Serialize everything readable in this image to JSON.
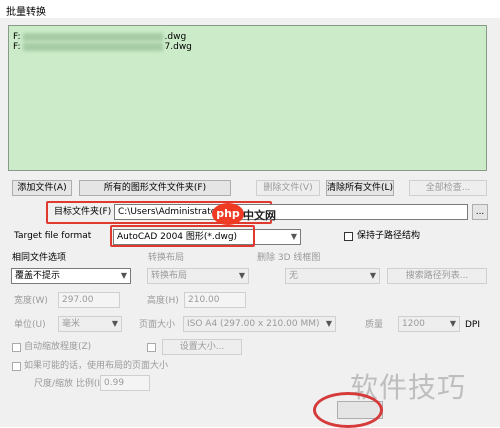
{
  "window": {
    "title": "批量转换"
  },
  "file_list": {
    "rows": [
      {
        "prefix": "F:",
        "suffix": ".dwg"
      },
      {
        "prefix": "F:",
        "suffix": "7.dwg"
      }
    ]
  },
  "buttons": {
    "add_file": "添加文件(A)",
    "add_folder": "所有的图形文件文件夹(F)",
    "remove_file": "删除文件(V)",
    "clear_all": "清除所有文件(L)",
    "preview": "全部检查...",
    "browse": "...",
    "settings": "设置大小..."
  },
  "target_folder": {
    "label": "目标文件夹(F)",
    "value": "C:\\Users\\Administrator\\Des"
  },
  "target_format": {
    "label": "Target file format",
    "value": "AutoCAD 2004 图形(*.dwg)"
  },
  "keep_subdir": {
    "label": "保持子路径结构"
  },
  "same_name": {
    "label": "相同文件选项",
    "value": "覆盖不提示"
  },
  "convert_layout": {
    "label": "转换布局",
    "value": "转换布局"
  },
  "delete_3d": {
    "label": "删除 3D 线框图",
    "value": "无"
  },
  "search_path": {
    "label": "搜索路径列表..."
  },
  "width": {
    "label": "宽度(W)",
    "value": "297.00"
  },
  "height": {
    "label": "高度(H)",
    "value": "210.00"
  },
  "unit": {
    "label": "单位(U)",
    "value": "毫米"
  },
  "page_size": {
    "label": "页面大小",
    "value": "ISO A4 (297.00 x 210.00 MM)"
  },
  "quality": {
    "label": "质量",
    "value": "1200",
    "unit": "DPI"
  },
  "auto_scale": {
    "label": "自动缩放程度(Z)"
  },
  "use_layout": {
    "label": "如果可能的话，使用布局的页面大小"
  },
  "ratio": {
    "label": "尺度/缩放 比例(I)",
    "value": "0.99"
  },
  "watermarks": {
    "php_logo": "php",
    "php_text": "中文网",
    "site": "软件技巧"
  },
  "colors": {
    "list_bg": "#ccecc9",
    "highlight_red": "#e03a2e",
    "dialog_bg": "#f0f0f0"
  }
}
